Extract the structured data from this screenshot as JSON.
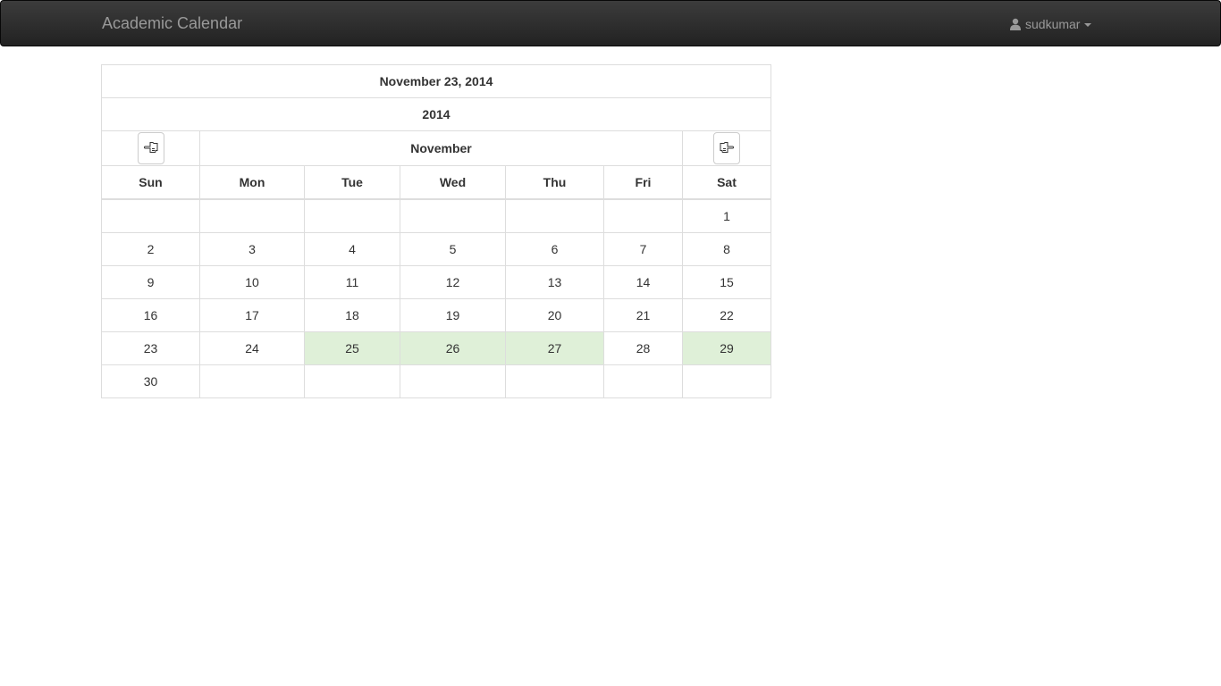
{
  "navbar": {
    "brand": "Academic Calendar",
    "user": "sudkumar",
    "user_icon": "user-icon"
  },
  "calendar": {
    "selected_date": "November 23, 2014",
    "year": "2014",
    "month": "November",
    "prev_icon": "hand-point-left-icon",
    "next_icon": "hand-point-right-icon",
    "weekdays": [
      "Sun",
      "Mon",
      "Tue",
      "Wed",
      "Thu",
      "Fri",
      "Sat"
    ],
    "weeks": [
      [
        "",
        "",
        "",
        "",
        "",
        "",
        "1"
      ],
      [
        "2",
        "3",
        "4",
        "5",
        "6",
        "7",
        "8"
      ],
      [
        "9",
        "10",
        "11",
        "12",
        "13",
        "14",
        "15"
      ],
      [
        "16",
        "17",
        "18",
        "19",
        "20",
        "21",
        "22"
      ],
      [
        "23",
        "24",
        "25",
        "26",
        "27",
        "28",
        "29"
      ],
      [
        "30",
        "",
        "",
        "",
        "",
        "",
        ""
      ]
    ],
    "highlighted_days": [
      "25",
      "26",
      "27",
      "29"
    ],
    "highlight_color": "#dff0d8"
  }
}
